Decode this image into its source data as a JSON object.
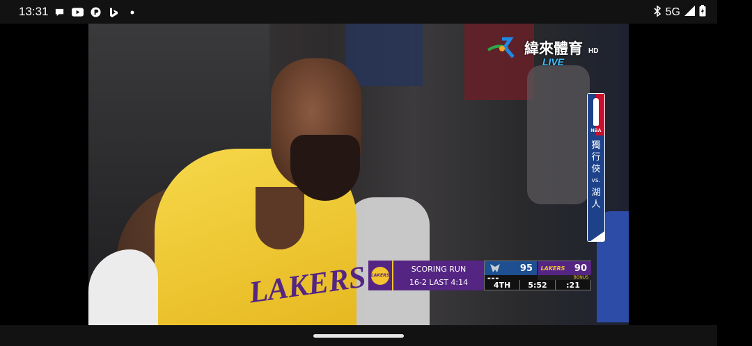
{
  "status_bar": {
    "time": "13:31",
    "notification_icons": [
      "chat-icon",
      "youtube-icon",
      "app-icon",
      "bing-icon",
      "dot-icon"
    ],
    "network": "5G",
    "icons": [
      "bluetooth-icon",
      "signal-icon",
      "battery-icon"
    ]
  },
  "broadcast": {
    "channel_name": "緯來體育",
    "channel_hd": "HD",
    "live_label": "LIVE",
    "matchup_side": {
      "league": "NBA",
      "team1": [
        "獨",
        "行",
        "俠"
      ],
      "vs": "vs.",
      "team2": [
        "湖",
        "人"
      ]
    },
    "jersey_text": "LAKERS"
  },
  "scorebug": {
    "home_logo_text": "LAKERS",
    "run_title": "SCORING RUN",
    "run_detail": "16-2 LAST 4:14",
    "away": {
      "abbr": "DAL",
      "score": "95"
    },
    "home": {
      "abbr": "LAKERS",
      "score": "90"
    },
    "bonus": "BONUS",
    "quarter": "4TH",
    "clock": "5:52",
    "shot_clock": ":21",
    "colors": {
      "lakers_purple": "#552583",
      "lakers_gold": "#f4c430",
      "mavs_blue": "#1d4f91"
    }
  }
}
